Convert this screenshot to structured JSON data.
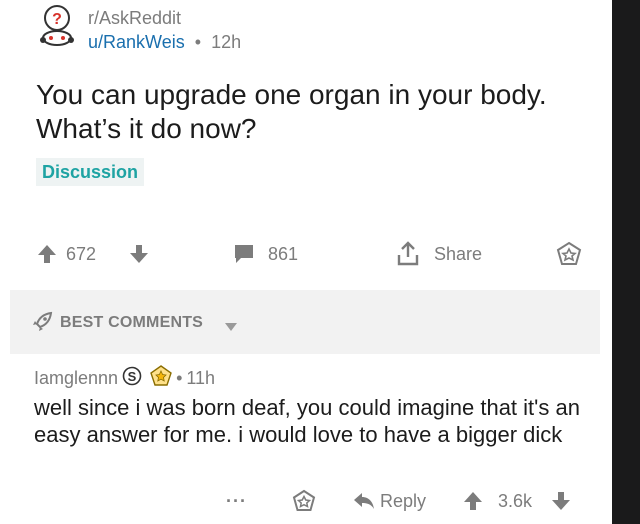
{
  "post": {
    "subreddit": "r/AskReddit",
    "author": "u/RankWeis",
    "separator": "•",
    "age": "12h",
    "title": "You can upgrade one organ in your body. What’s it do now?",
    "flair": "Discussion",
    "score": "672",
    "comment_count": "861",
    "share_label": "Share"
  },
  "sort_bar": {
    "label": "BEST COMMENTS"
  },
  "comment": {
    "author": "Iamglennn",
    "separator": "•",
    "age": "11h",
    "body": "well since i was born deaf, you could imagine that it's an easy answer for me. i would love to have a bigger dick",
    "more_label": "···",
    "reply_label": "Reply",
    "score": "3.6k"
  },
  "colors": {
    "meta_text": "#7c7c7c",
    "username": "#1a6fae",
    "flair_text": "#1ea3a3",
    "flair_bg": "#eef3f3",
    "sort_bar_bg": "#f2f2f2"
  },
  "icons": {
    "subreddit_avatar": "askreddit-snoo-question-icon",
    "upvote": "up-arrow-icon",
    "downvote": "down-arrow-icon",
    "comments": "comment-bubble-icon",
    "share": "share-icon",
    "save": "star-outline-icon",
    "best": "rocket-icon",
    "sort_caret": "caret-down-icon",
    "reply": "reply-arrow-icon",
    "mod_badge": "s-badge-icon",
    "award": "star-badge-icon"
  }
}
